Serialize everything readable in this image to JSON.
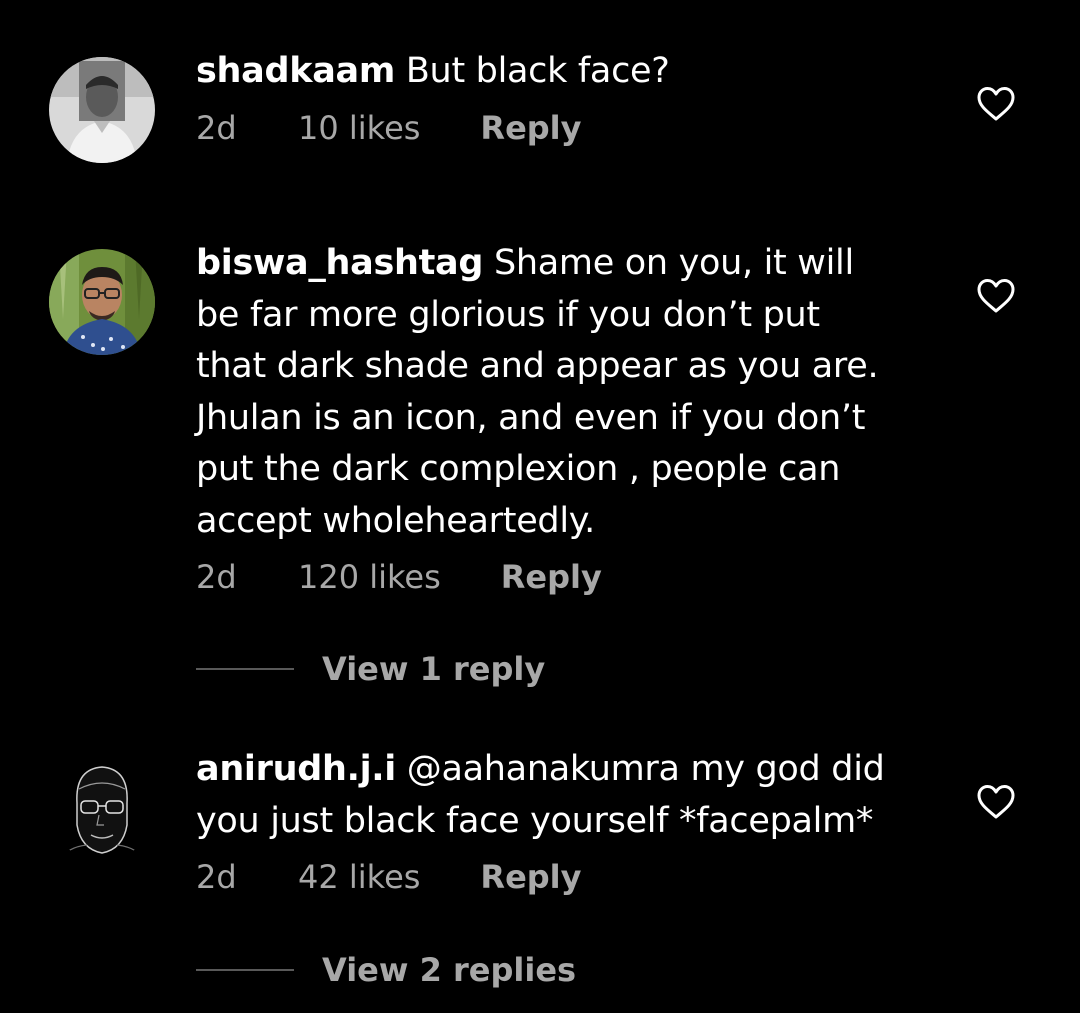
{
  "comments": [
    {
      "username": "shadkaam",
      "text": "But black face?",
      "time": "2d",
      "likes": "10 likes",
      "reply_label": "Reply",
      "avatar_icon": "profile-photo-grayscale-man"
    },
    {
      "username": "biswa_hashtag",
      "text": "Shame on you, it will\nbe far more glorious if you don’t put\nthat dark shade and appear as you are.\nJhulan is an icon, and even if you don’t\nput the dark complexion , people can\naccept wholeheartedly.",
      "time": "2d",
      "likes": "120 likes",
      "reply_label": "Reply",
      "view_replies": "View 1 reply",
      "avatar_icon": "profile-photo-man-with-glasses"
    },
    {
      "username": "anirudh.j.i",
      "text": "@aahanakumra my god did\nyou just black face yourself *facepalm*",
      "time": "2d",
      "likes": "42 likes",
      "reply_label": "Reply",
      "view_replies": "View 2 replies",
      "avatar_icon": "profile-photo-dark-face-outline"
    }
  ],
  "colors": {
    "background": "#000000",
    "text_primary": "#ffffff",
    "text_secondary": "#a8a8a8",
    "reply_line": "#595959"
  },
  "icons": {
    "like": "heart-outline-icon"
  }
}
